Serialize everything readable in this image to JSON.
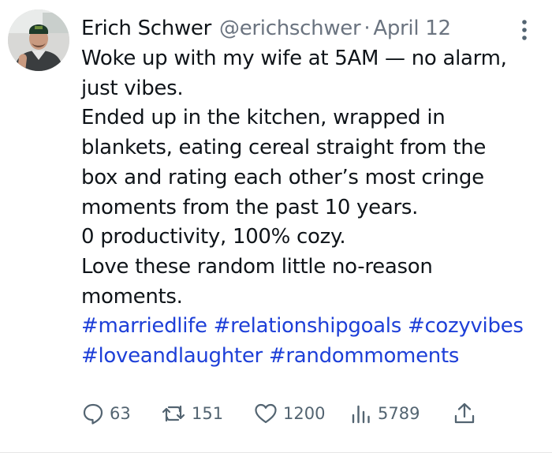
{
  "author": {
    "name": "Erich Schwer",
    "handle": "@erichschwer",
    "separator": "·",
    "date": "April 12",
    "avatar_icon": "profile-photo"
  },
  "more_icon": "more-vertical-icon",
  "post": {
    "lines": [
      "Woke up with my wife at 5AM — no alarm,",
      "just vibes.",
      "Ended up in the kitchen, wrapped in",
      "blankets, eating cereal straight from the",
      "box and rating each other’s most cringe",
      "moments from the past 10 years.",
      "0 productivity, 100% cozy.",
      "Love these random little no-reason",
      "moments."
    ],
    "hashtags_line1": [
      "#marriedlife",
      "#relationshipgoals",
      "#cozyvibes"
    ],
    "hashtags_line2": [
      "#loveandlaughter",
      "#randommoments"
    ]
  },
  "actions": {
    "replies": "63",
    "reposts": "151",
    "likes": "1200",
    "views": "5789",
    "share_icon": "share-icon"
  },
  "colors": {
    "text": "#0f1419",
    "muted": "#6b7480",
    "link": "#1d3fd8",
    "icon": "#536471"
  }
}
